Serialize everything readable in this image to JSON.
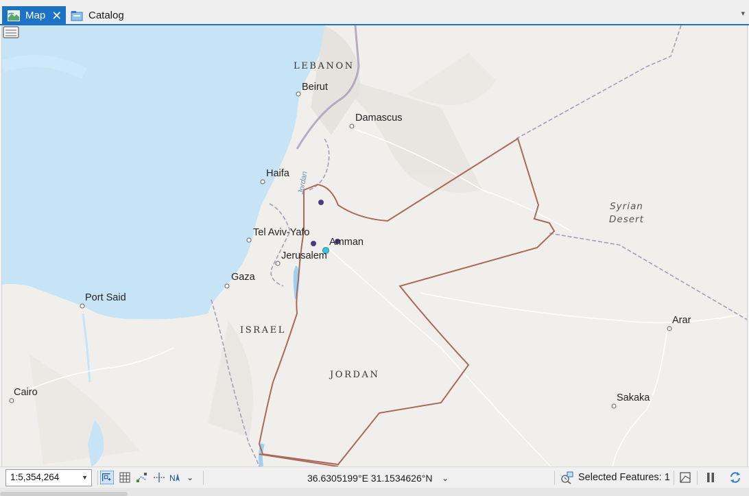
{
  "tabs": [
    {
      "label": "Map",
      "active": true,
      "icon": "map-icon"
    },
    {
      "label": "Catalog",
      "active": false,
      "icon": "catalog-icon"
    }
  ],
  "map": {
    "labels": {
      "lebanon": "LEBANON",
      "beirut": "Beirut",
      "damascus": "Damascus",
      "haifa": "Haifa",
      "jordan_river": "Jordan",
      "tel_aviv": "Tel Aviv-Yafo",
      "amman": "Amman",
      "jerusalem": "Jerusalem",
      "gaza": "Gaza",
      "port_said": "Port Said",
      "israel": "ISRAEL",
      "jordan": "JORDAN",
      "cairo": "Cairo",
      "syrian_desert_1": "Syrian",
      "syrian_desert_2": "Desert",
      "arar": "Arar",
      "sakaka": "Sakaka"
    },
    "colors": {
      "sea": "#c6e4f6",
      "land": "#f1efec",
      "border": "#a9685a",
      "border_dashed": "#a79ab8",
      "point": "#4b3b86",
      "selected_point": "#38c5d9"
    },
    "feature_points": [
      {
        "name": "point-north",
        "selected": false
      },
      {
        "name": "point-west",
        "selected": false
      },
      {
        "name": "point-amman",
        "selected": false
      },
      {
        "name": "point-selected",
        "selected": true
      }
    ]
  },
  "statusbar": {
    "scale": "1:5,354,264",
    "coordinates": "36.6305199°E 31.1534626°N",
    "selected_features": "Selected Features: 1"
  }
}
